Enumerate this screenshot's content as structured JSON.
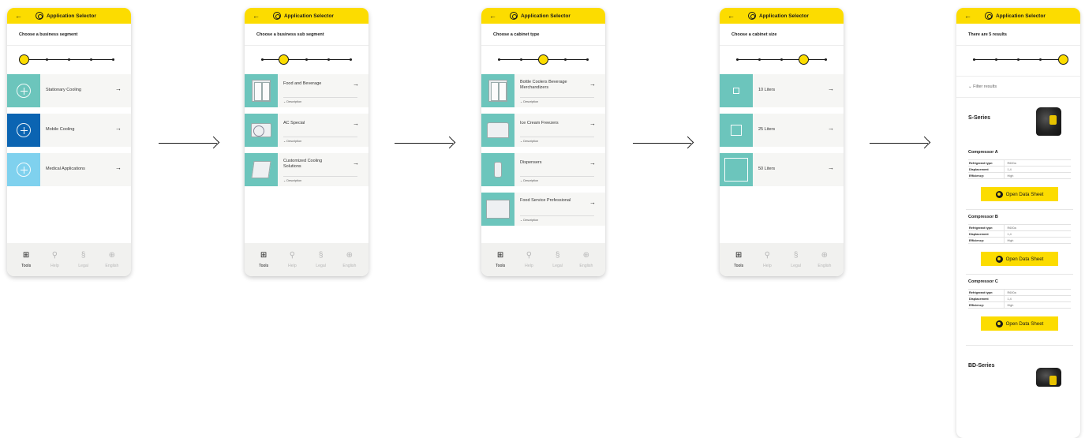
{
  "app": {
    "back_icon": "arrow-left-icon",
    "logo_icon": "application-logo-icon",
    "title": "Application Selector"
  },
  "nav": [
    {
      "icon": "grid-icon",
      "glyph": "⊞",
      "label": "Tools"
    },
    {
      "icon": "search-icon",
      "glyph": "⚲",
      "label": "Help"
    },
    {
      "icon": "section-icon",
      "glyph": "§",
      "label": "Legal"
    },
    {
      "icon": "globe-icon",
      "glyph": "⊕",
      "label": "English"
    }
  ],
  "screens": [
    {
      "heading": "Choose a business segment",
      "step": 1,
      "items": [
        {
          "label": "Stationary Cooling",
          "arrow": "→",
          "tile_color": "#6cc5bc"
        },
        {
          "label": "Mobile Cooling",
          "arrow": "→",
          "tile_color": "#0b64b2"
        },
        {
          "label": "Medical Applications",
          "arrow": "→",
          "tile_color": "#7fd1ee"
        }
      ]
    },
    {
      "heading": "Choose a business sub segment",
      "step": 2,
      "items": [
        {
          "label": "Food and Beverage",
          "arrow": "→",
          "description": "⌄ Description"
        },
        {
          "label": "AC Special",
          "arrow": "→",
          "description": "⌄ Description"
        },
        {
          "label": "Customized Cooling Solutions",
          "arrow": "→",
          "description": "⌄ Description"
        }
      ]
    },
    {
      "heading": "Choose a cabinet type",
      "step": 3,
      "items": [
        {
          "label": "Bottle Coolers Beverage Merchandizers",
          "arrow": "→",
          "description": "⌄ Description"
        },
        {
          "label": "Ice Cream Freezers",
          "arrow": "→",
          "description": "⌄ Description"
        },
        {
          "label": "Dispensers",
          "arrow": "→",
          "description": "⌄ Description"
        },
        {
          "label": "Food Service Professional",
          "arrow": "→",
          "description": "⌄ Description"
        }
      ]
    },
    {
      "heading": "Choose a cabinet size",
      "step": 4,
      "items": [
        {
          "label": "10 Liters",
          "arrow": "→"
        },
        {
          "label": "25 Liters",
          "arrow": "→"
        },
        {
          "label": "50 Liters",
          "arrow": "→"
        }
      ]
    },
    {
      "heading": "There are 5 results",
      "step": 5,
      "filter": "⌄  Filter results",
      "series": [
        {
          "name": "S-Series",
          "compressors": [
            {
              "name": "Compressor A",
              "specs": [
                [
                  "Refrigerant type:",
                  "R600a"
                ],
                [
                  "Displacement",
                  "1,4"
                ],
                [
                  "Efficiency:",
                  "High"
                ]
              ],
              "button": "Open Data Sheet"
            },
            {
              "name": "Compressor B",
              "specs": [
                [
                  "Refrigerant type:",
                  "R600a"
                ],
                [
                  "Displacement",
                  "1,4"
                ],
                [
                  "Efficiency:",
                  "High"
                ]
              ],
              "button": "Open Data Sheet"
            },
            {
              "name": "Compressor C",
              "specs": [
                [
                  "Refrigerant type:",
                  "R600a"
                ],
                [
                  "Displacement",
                  "1,4"
                ],
                [
                  "Efficiency:",
                  "High"
                ]
              ],
              "button": "Open Data Sheet"
            }
          ]
        },
        {
          "name": "BD-Series"
        }
      ]
    }
  ],
  "flow_arrows": [
    "arrow-right-icon",
    "arrow-right-icon",
    "arrow-right-icon",
    "arrow-right-icon"
  ],
  "colors": {
    "accent": "#fcdc00",
    "teal": "#6cc5bc",
    "blue": "#0b64b2",
    "light_blue": "#7fd1ee"
  }
}
